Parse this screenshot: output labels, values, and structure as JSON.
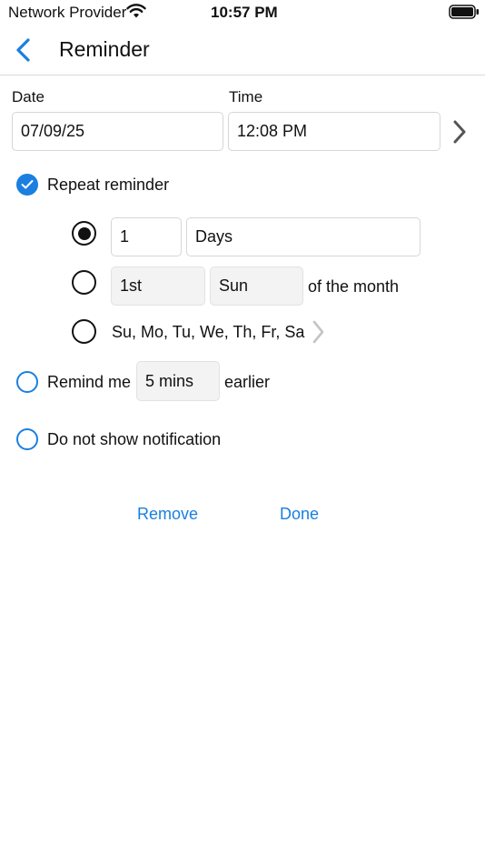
{
  "status_bar": {
    "carrier": "Network Provider",
    "time": "10:57 PM"
  },
  "nav": {
    "title": "Reminder"
  },
  "date": {
    "label": "Date",
    "value": "07/09/25"
  },
  "time": {
    "label": "Time",
    "value": "12:08 PM"
  },
  "repeat": {
    "label": "Repeat reminder",
    "checked": true,
    "interval": {
      "count": "1",
      "unit": "Days"
    },
    "monthly": {
      "ordinal": "1st",
      "weekday": "Sun",
      "suffix": "of the month"
    },
    "weekdays": {
      "value": "Su, Mo, Tu, We, Th, Fr, Sa"
    }
  },
  "remind_me": {
    "prefix": "Remind me",
    "value": "5 mins",
    "suffix": "earlier"
  },
  "no_notification": {
    "label": "Do not show notification"
  },
  "actions": {
    "remove": "Remove",
    "done": "Done"
  },
  "colors": {
    "accent": "#1a7fe0"
  }
}
